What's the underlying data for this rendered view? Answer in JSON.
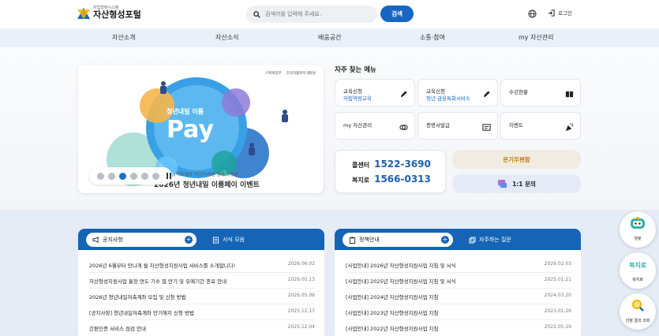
{
  "header": {
    "logo_small": "자립형정시스템",
    "logo_main": "자산형성포털",
    "search_placeholder": "검색어를 입력해 주세요.",
    "search_button": "검색",
    "login_label": "로그인"
  },
  "nav": [
    "자산소개",
    "자산소식",
    "배움공간",
    "소통·참여",
    "my 자산관리"
  ],
  "banner": {
    "logo1": "기획재정부",
    "logo2": "한국자활복지개발원",
    "hero_small": "청년내일 이룸",
    "hero_big": "Pay",
    "sub": "[지축계좌 가입자]라면 참여 가능한",
    "title": "2026년 청년내일 이룸페이 이벤트"
  },
  "quick": {
    "title": "자주 찾는 메뉴",
    "items": [
      {
        "l1": "교육신청",
        "l2": "자립역량교육",
        "icon": "pencil-icon"
      },
      {
        "l1": "교육신청",
        "l2": "청년 금융특화서비스",
        "icon": "pencil-icon"
      },
      {
        "l1": "수강현황",
        "l2": "",
        "icon": "book-icon"
      },
      {
        "l1": "my 자산관리",
        "l2": "",
        "icon": "coins-icon"
      },
      {
        "l1": "증명서발급",
        "l2": "",
        "icon": "certificate-icon"
      },
      {
        "l1": "이벤트",
        "l2": "",
        "icon": "party-icon"
      }
    ]
  },
  "contact": {
    "call_label": "콜센터",
    "call_number": "1522-3690",
    "welfare_label": "복지로",
    "welfare_number": "1566-0313",
    "online": "온기우편함",
    "inquiry": "1:1 문의"
  },
  "notice": {
    "tab_active": "공지사항",
    "tab_other": "서식 모음",
    "rows": [
      {
        "title": "2026년 6월부터 만나게 될 자산형성지원사업 서비스를 소개합니다!",
        "date": "2026.06.02"
      },
      {
        "title": "자산형성지원사업 통장 연도·기수 별 만기 및 유예기간 종료 안내",
        "date": "2026.05.13"
      },
      {
        "title": "2026년 청년내일저축계좌 모집 및 신청 방법",
        "date": "2026.05.06"
      },
      {
        "title": "[공지사항] 청년내일저축계좌 만기해지 신청 방법",
        "date": "2025.12.17"
      },
      {
        "title": "간편인증 서비스 점검 안내",
        "date": "2025.12.04"
      }
    ]
  },
  "policy": {
    "tab_active": "정책안내",
    "tab_other": "자주하는 질문",
    "rows": [
      {
        "title": "[사업안내] 2026년 자산형성지원사업 지침 및 서식",
        "date": "2026.02.03"
      },
      {
        "title": "[사업안내] 2025년 자산형성지원사업 지침 및 서식",
        "date": "2025.01.21"
      },
      {
        "title": "[사업안내] 2024년 자산형성지원사업 지침",
        "date": "2024.03.20"
      },
      {
        "title": "[사업안내] 2023년 자산형성지원사업 지침",
        "date": "2023.01.26"
      },
      {
        "title": "[사업안내] 2022년 자산형성지원사업 지침",
        "date": "2022.05.19"
      }
    ]
  },
  "side": {
    "chatbot": "챗봇",
    "welfare_logo": "복지로",
    "welfare": "복지로",
    "result": "선정 결과 조회"
  },
  "colors": {
    "primary": "#1564b5",
    "accent": "#1a5fae",
    "nav_bg": "#eaf0f9"
  }
}
